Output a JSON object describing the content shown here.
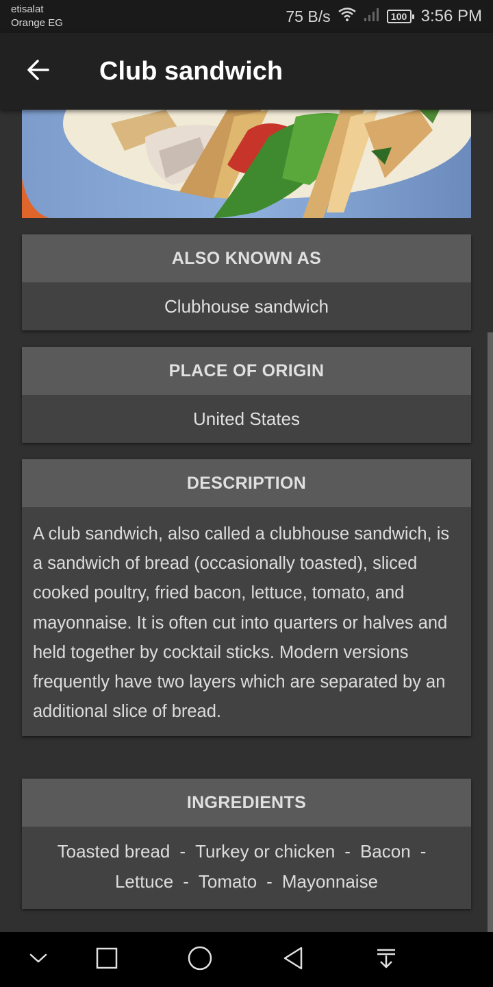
{
  "status_bar": {
    "carrier_line1": "etisalat",
    "carrier_line2": "Orange EG",
    "net_speed": "75 B/s",
    "battery": "100",
    "time": "3:56 PM",
    "icons": [
      "wifi-icon",
      "signal-icon",
      "battery-icon"
    ]
  },
  "app_bar": {
    "title": "Club sandwich",
    "back_icon": "arrow-back-icon"
  },
  "photo": {
    "subject": "club-sandwich-photo"
  },
  "also_known_as": {
    "heading": "ALSO KNOWN AS",
    "value": "Clubhouse sandwich"
  },
  "place_of_origin": {
    "heading": "PLACE OF ORIGIN",
    "value": "United States"
  },
  "description": {
    "heading": "DESCRIPTION",
    "text": "A club sandwich, also called a clubhouse sandwich, is a sandwich of bread (occasionally toasted), sliced cooked poultry, fried bacon, lettuce, tomato, and mayonnaise. It is often cut into quarters or halves and held together by cocktail sticks. Modern versions frequently have two layers which are separated by an additional slice of bread."
  },
  "ingredients": {
    "heading": "INGREDIENTS",
    "separator": "-",
    "items": [
      "Toasted bread",
      "Turkey or chicken",
      "Bacon",
      "Lettuce",
      "Tomato",
      "Mayonnaise"
    ]
  },
  "nav_bar": {
    "icons": [
      "chevron-down-icon",
      "recents-square-icon",
      "home-circle-icon",
      "back-triangle-icon",
      "notification-pull-icon"
    ]
  },
  "colors": {
    "background": "#303030",
    "app_bar": "#212121",
    "card": "#424242",
    "card_header": "#5a5a5a"
  }
}
